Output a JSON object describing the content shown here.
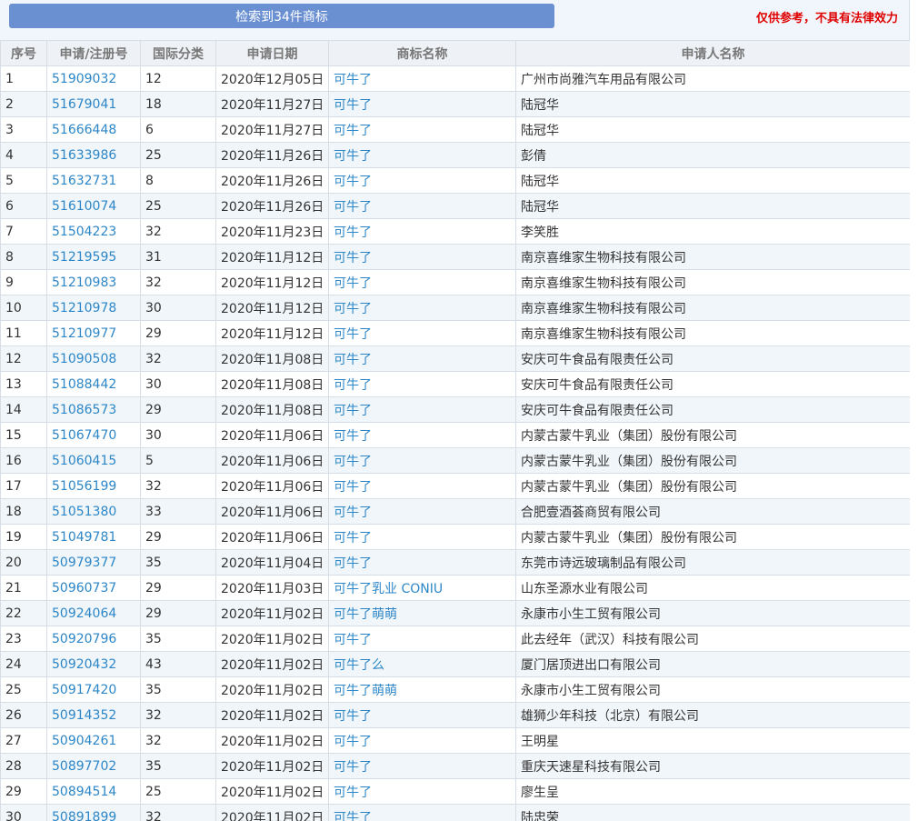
{
  "toolbar": {
    "result_button_label": "检索到34件商标",
    "disclaimer": "仅供参考，不具有法律效力"
  },
  "table": {
    "headers": [
      "序号",
      "申请/注册号",
      "国际分类",
      "申请日期",
      "商标名称",
      "申请人名称"
    ],
    "rows": [
      [
        "1",
        "51909032",
        "12",
        "2020年12月05日",
        "可牛了",
        "广州市尚雅汽车用品有限公司"
      ],
      [
        "2",
        "51679041",
        "18",
        "2020年11月27日",
        "可牛了",
        "陆冠华"
      ],
      [
        "3",
        "51666448",
        "6",
        "2020年11月27日",
        "可牛了",
        "陆冠华"
      ],
      [
        "4",
        "51633986",
        "25",
        "2020年11月26日",
        "可牛了",
        "彭倩"
      ],
      [
        "5",
        "51632731",
        "8",
        "2020年11月26日",
        "可牛了",
        "陆冠华"
      ],
      [
        "6",
        "51610074",
        "25",
        "2020年11月26日",
        "可牛了",
        "陆冠华"
      ],
      [
        "7",
        "51504223",
        "32",
        "2020年11月23日",
        "可牛了",
        "李笑胜"
      ],
      [
        "8",
        "51219595",
        "31",
        "2020年11月12日",
        "可牛了",
        "南京喜维家生物科技有限公司"
      ],
      [
        "9",
        "51210983",
        "32",
        "2020年11月12日",
        "可牛了",
        "南京喜维家生物科技有限公司"
      ],
      [
        "10",
        "51210978",
        "30",
        "2020年11月12日",
        "可牛了",
        "南京喜维家生物科技有限公司"
      ],
      [
        "11",
        "51210977",
        "29",
        "2020年11月12日",
        "可牛了",
        "南京喜维家生物科技有限公司"
      ],
      [
        "12",
        "51090508",
        "32",
        "2020年11月08日",
        "可牛了",
        "安庆可牛食品有限责任公司"
      ],
      [
        "13",
        "51088442",
        "30",
        "2020年11月08日",
        "可牛了",
        "安庆可牛食品有限责任公司"
      ],
      [
        "14",
        "51086573",
        "29",
        "2020年11月08日",
        "可牛了",
        "安庆可牛食品有限责任公司"
      ],
      [
        "15",
        "51067470",
        "30",
        "2020年11月06日",
        "可牛了",
        "内蒙古蒙牛乳业（集团）股份有限公司"
      ],
      [
        "16",
        "51060415",
        "5",
        "2020年11月06日",
        "可牛了",
        "内蒙古蒙牛乳业（集团）股份有限公司"
      ],
      [
        "17",
        "51056199",
        "32",
        "2020年11月06日",
        "可牛了",
        "内蒙古蒙牛乳业（集团）股份有限公司"
      ],
      [
        "18",
        "51051380",
        "33",
        "2020年11月06日",
        "可牛了",
        "合肥壹酒荟商贸有限公司"
      ],
      [
        "19",
        "51049781",
        "29",
        "2020年11月06日",
        "可牛了",
        "内蒙古蒙牛乳业（集团）股份有限公司"
      ],
      [
        "20",
        "50979377",
        "35",
        "2020年11月04日",
        "可牛了",
        "东莞市诗远玻璃制品有限公司"
      ],
      [
        "21",
        "50960737",
        "29",
        "2020年11月03日",
        "可牛了乳业 CONIU",
        "山东圣源水业有限公司"
      ],
      [
        "22",
        "50924064",
        "29",
        "2020年11月02日",
        "可牛了萌萌",
        "永康市小生工贸有限公司"
      ],
      [
        "23",
        "50920796",
        "35",
        "2020年11月02日",
        "可牛了",
        "此去经年（武汉）科技有限公司"
      ],
      [
        "24",
        "50920432",
        "43",
        "2020年11月02日",
        "可牛了么",
        "厦门居顶进出口有限公司"
      ],
      [
        "25",
        "50917420",
        "35",
        "2020年11月02日",
        "可牛了萌萌",
        "永康市小生工贸有限公司"
      ],
      [
        "26",
        "50914352",
        "32",
        "2020年11月02日",
        "可牛了",
        "雄狮少年科技（北京）有限公司"
      ],
      [
        "27",
        "50904261",
        "32",
        "2020年11月02日",
        "可牛了",
        "王明星"
      ],
      [
        "28",
        "50897702",
        "35",
        "2020年11月02日",
        "可牛了",
        "重庆天速星科技有限公司"
      ],
      [
        "29",
        "50894514",
        "25",
        "2020年11月02日",
        "可牛了",
        "廖生呈"
      ],
      [
        "30",
        "50891899",
        "32",
        "2020年11月02日",
        "可牛了",
        "陆忠荣"
      ]
    ]
  },
  "colors": {
    "button_bg": "#6a90d2",
    "disclaimer": "#e00000",
    "link": "#2c86c8",
    "header_bg": "#eef2f6",
    "stripe_bg": "#f1f6fa"
  }
}
